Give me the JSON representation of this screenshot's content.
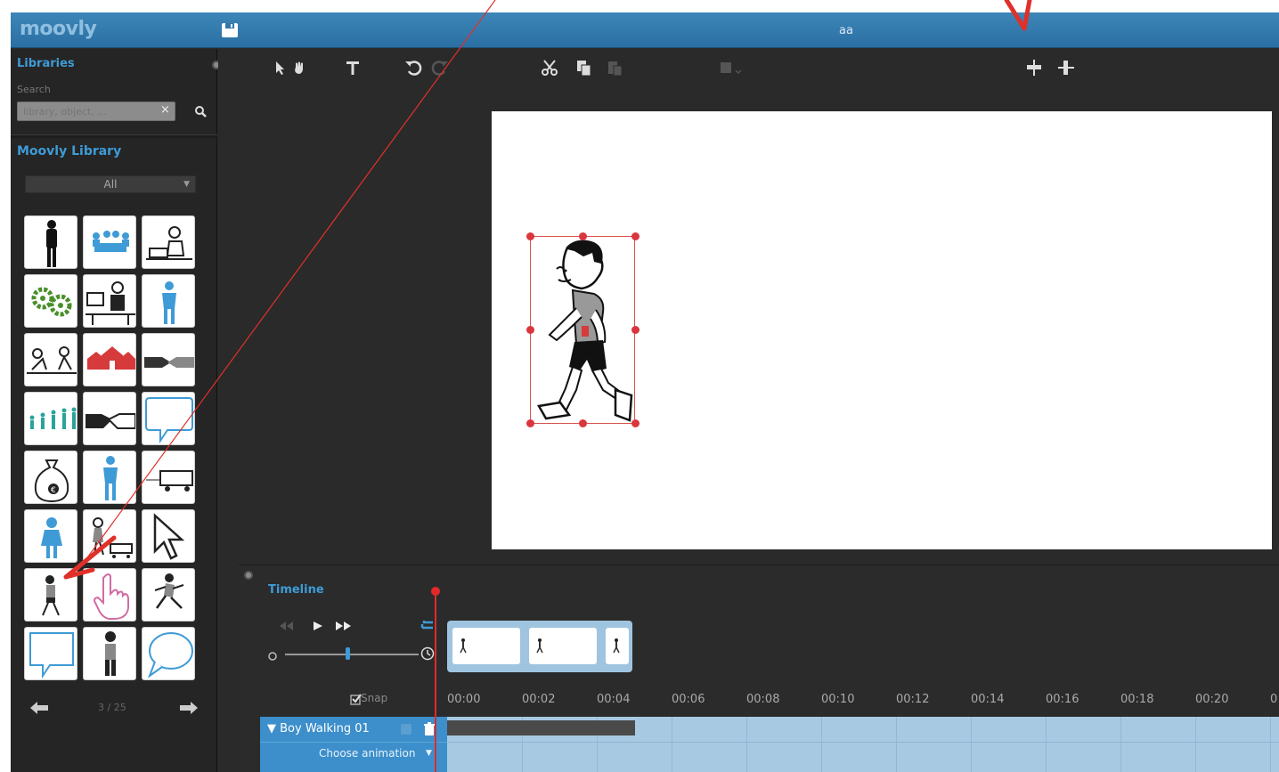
{
  "app": {
    "logo": "moovly",
    "document_title": "aa"
  },
  "colors": {
    "accent": "#3e9bd6",
    "titlebar": "#2f79ad",
    "selection": "#d9363e",
    "playhead": "#e02a2a",
    "track": "#a8c9e2"
  },
  "libraries": {
    "heading": "Libraries",
    "search_label": "Search",
    "search_placeholder": "library, object, ...",
    "clear_icon": "close-icon",
    "search_icon": "search-icon"
  },
  "moovly_library": {
    "heading": "Moovly Library",
    "category": "All",
    "items": [
      "silhouette-man",
      "meeting",
      "laptop-worker",
      "gears",
      "office-worker",
      "blue-person",
      "consultation",
      "red-houses",
      "handshake",
      "evolution",
      "handshake-bw",
      "speech-bubble",
      "money-bag",
      "blue-person-standing",
      "delivery-truck",
      "blue-girl",
      "boy-with-cart",
      "cursor-arrow",
      "boy-walking",
      "hand-pointer",
      "boy-running",
      "speech-box",
      "boy-standing",
      "round-speech-bubble"
    ],
    "pager": "3 / 25"
  },
  "toolbar": {
    "tools": [
      "select-arrow-icon",
      "hand-icon",
      "text-tool-icon",
      "undo-icon",
      "redo-icon",
      "cut-icon",
      "copy-icon",
      "paste-icon",
      "arrange-icon",
      "align-horizontal-icon",
      "align-vertical-icon"
    ]
  },
  "timeline": {
    "heading": "Timeline",
    "snap_label": "Snap",
    "ruler": [
      "00:00",
      "00:02",
      "00:04",
      "00:06",
      "00:08",
      "00:10",
      "00:12",
      "00:14",
      "00:16",
      "00:18",
      "00:20",
      "0"
    ],
    "track": {
      "name": "Boy Walking 01",
      "animation": "Choose animation"
    }
  }
}
